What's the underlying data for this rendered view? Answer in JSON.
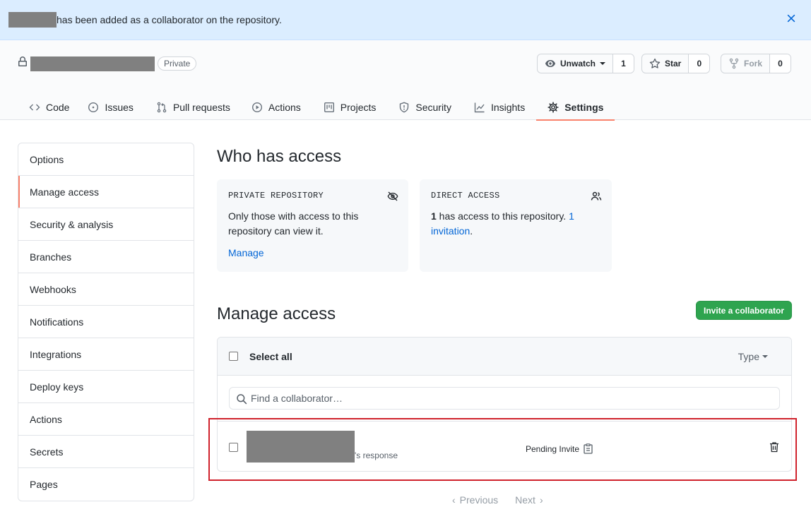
{
  "flash": {
    "message": "has been added as a collaborator on the repository."
  },
  "repo": {
    "visibility": "Private",
    "watch": {
      "label": "Unwatch",
      "count": "1"
    },
    "star": {
      "label": "Star",
      "count": "0"
    },
    "fork": {
      "label": "Fork",
      "count": "0"
    }
  },
  "tabs": [
    {
      "label": "Code",
      "icon": "code-icon"
    },
    {
      "label": "Issues",
      "icon": "issue-icon"
    },
    {
      "label": "Pull requests",
      "icon": "pull-request-icon"
    },
    {
      "label": "Actions",
      "icon": "play-icon"
    },
    {
      "label": "Projects",
      "icon": "project-icon"
    },
    {
      "label": "Security",
      "icon": "shield-icon"
    },
    {
      "label": "Insights",
      "icon": "graph-icon"
    },
    {
      "label": "Settings",
      "icon": "gear-icon",
      "selected": true
    }
  ],
  "sidebar": {
    "items": [
      {
        "label": "Options"
      },
      {
        "label": "Manage access",
        "selected": true
      },
      {
        "label": "Security & analysis"
      },
      {
        "label": "Branches"
      },
      {
        "label": "Webhooks"
      },
      {
        "label": "Notifications"
      },
      {
        "label": "Integrations"
      },
      {
        "label": "Deploy keys"
      },
      {
        "label": "Actions"
      },
      {
        "label": "Secrets"
      },
      {
        "label": "Pages"
      }
    ]
  },
  "who_has_access": {
    "title": "Who has access",
    "private_card": {
      "title": "PRIVATE REPOSITORY",
      "body": "Only those with access to this repository can view it.",
      "link": "Manage"
    },
    "direct_card": {
      "title": "DIRECT ACCESS",
      "count": "1",
      "text": " has access to this repository. ",
      "invitation_link": "1 invitation",
      "period": "."
    }
  },
  "manage_access": {
    "title": "Manage access",
    "invite_button": "Invite a collaborator",
    "select_all": "Select all",
    "type_filter": "Type",
    "search_placeholder": "Find a collaborator…",
    "rows": [
      {
        "subtext": "'s response",
        "status": "Pending Invite"
      }
    ]
  },
  "pagination": {
    "previous": "Previous",
    "next": "Next"
  },
  "colors": {
    "accent_tab": "#f9826c",
    "primary_button": "#2ea44f",
    "link": "#0366d6",
    "highlight_box": "#d0222c"
  }
}
